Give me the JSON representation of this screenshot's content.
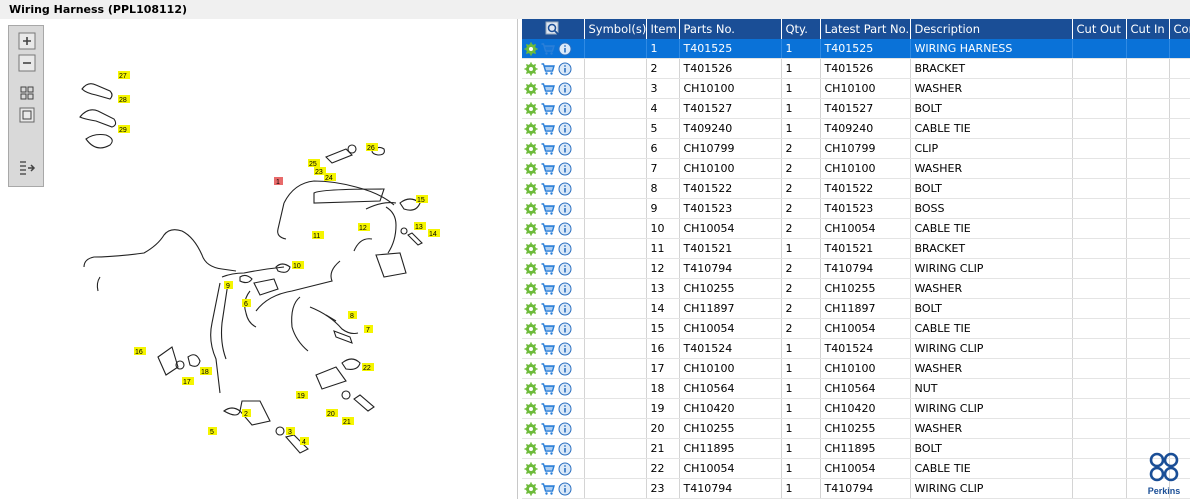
{
  "title": "Wiring Harness (PPL108112)",
  "toolbar": {
    "zoom_in_icon": "zoom-in-icon",
    "zoom_out_icon": "zoom-out-icon",
    "fit_icon": "fit-all-icon",
    "frame_icon": "frame-icon",
    "export_icon": "export-list-icon"
  },
  "diagram": {
    "callouts": [
      "1",
      "2",
      "3",
      "4",
      "5",
      "6",
      "7",
      "8",
      "9",
      "10",
      "11",
      "12",
      "13",
      "14",
      "15",
      "16",
      "17",
      "18",
      "19",
      "20",
      "21",
      "22",
      "23",
      "24",
      "25",
      "26",
      "27",
      "28",
      "29"
    ]
  },
  "table": {
    "columns": [
      "",
      "Symbol(s)",
      "Item",
      "Parts No.",
      "Qty.",
      "Latest Part No.",
      "Description",
      "Cut Out",
      "Cut In",
      "Comment"
    ],
    "rows": [
      {
        "item": "1",
        "part": "T401525",
        "qty": "1",
        "latest": "T401525",
        "desc": "WIRING HARNESS"
      },
      {
        "item": "2",
        "part": "T401526",
        "qty": "1",
        "latest": "T401526",
        "desc": "BRACKET"
      },
      {
        "item": "3",
        "part": "CH10100",
        "qty": "1",
        "latest": "CH10100",
        "desc": "WASHER"
      },
      {
        "item": "4",
        "part": "T401527",
        "qty": "1",
        "latest": "T401527",
        "desc": "BOLT"
      },
      {
        "item": "5",
        "part": "T409240",
        "qty": "1",
        "latest": "T409240",
        "desc": "CABLE TIE"
      },
      {
        "item": "6",
        "part": "CH10799",
        "qty": "2",
        "latest": "CH10799",
        "desc": "CLIP"
      },
      {
        "item": "7",
        "part": "CH10100",
        "qty": "2",
        "latest": "CH10100",
        "desc": "WASHER"
      },
      {
        "item": "8",
        "part": "T401522",
        "qty": "2",
        "latest": "T401522",
        "desc": "BOLT"
      },
      {
        "item": "9",
        "part": "T401523",
        "qty": "2",
        "latest": "T401523",
        "desc": "BOSS"
      },
      {
        "item": "10",
        "part": "CH10054",
        "qty": "2",
        "latest": "CH10054",
        "desc": "CABLE TIE"
      },
      {
        "item": "11",
        "part": "T401521",
        "qty": "1",
        "latest": "T401521",
        "desc": "BRACKET"
      },
      {
        "item": "12",
        "part": "T410794",
        "qty": "2",
        "latest": "T410794",
        "desc": "WIRING CLIP"
      },
      {
        "item": "13",
        "part": "CH10255",
        "qty": "2",
        "latest": "CH10255",
        "desc": "WASHER"
      },
      {
        "item": "14",
        "part": "CH11897",
        "qty": "2",
        "latest": "CH11897",
        "desc": "BOLT"
      },
      {
        "item": "15",
        "part": "CH10054",
        "qty": "2",
        "latest": "CH10054",
        "desc": "CABLE TIE"
      },
      {
        "item": "16",
        "part": "T401524",
        "qty": "1",
        "latest": "T401524",
        "desc": "WIRING CLIP"
      },
      {
        "item": "17",
        "part": "CH10100",
        "qty": "1",
        "latest": "CH10100",
        "desc": "WASHER"
      },
      {
        "item": "18",
        "part": "CH10564",
        "qty": "1",
        "latest": "CH10564",
        "desc": "NUT"
      },
      {
        "item": "19",
        "part": "CH10420",
        "qty": "1",
        "latest": "CH10420",
        "desc": "WIRING CLIP"
      },
      {
        "item": "20",
        "part": "CH10255",
        "qty": "1",
        "latest": "CH10255",
        "desc": "WASHER"
      },
      {
        "item": "21",
        "part": "CH11895",
        "qty": "1",
        "latest": "CH11895",
        "desc": "BOLT"
      },
      {
        "item": "22",
        "part": "CH10054",
        "qty": "1",
        "latest": "CH10054",
        "desc": "CABLE TIE"
      },
      {
        "item": "23",
        "part": "T410794",
        "qty": "1",
        "latest": "T410794",
        "desc": "WIRING CLIP"
      }
    ],
    "selected_row": 0,
    "row_icons": [
      "gear-icon",
      "cart-icon",
      "info-icon"
    ]
  },
  "brand": {
    "name": "Perkins",
    "color": "#1a4e96"
  },
  "colors": {
    "header_bg": "#1a4e96",
    "selected_row": "#0a72d8",
    "callout_bg": "#f5f500",
    "callout_selected": "#e86a6a"
  }
}
